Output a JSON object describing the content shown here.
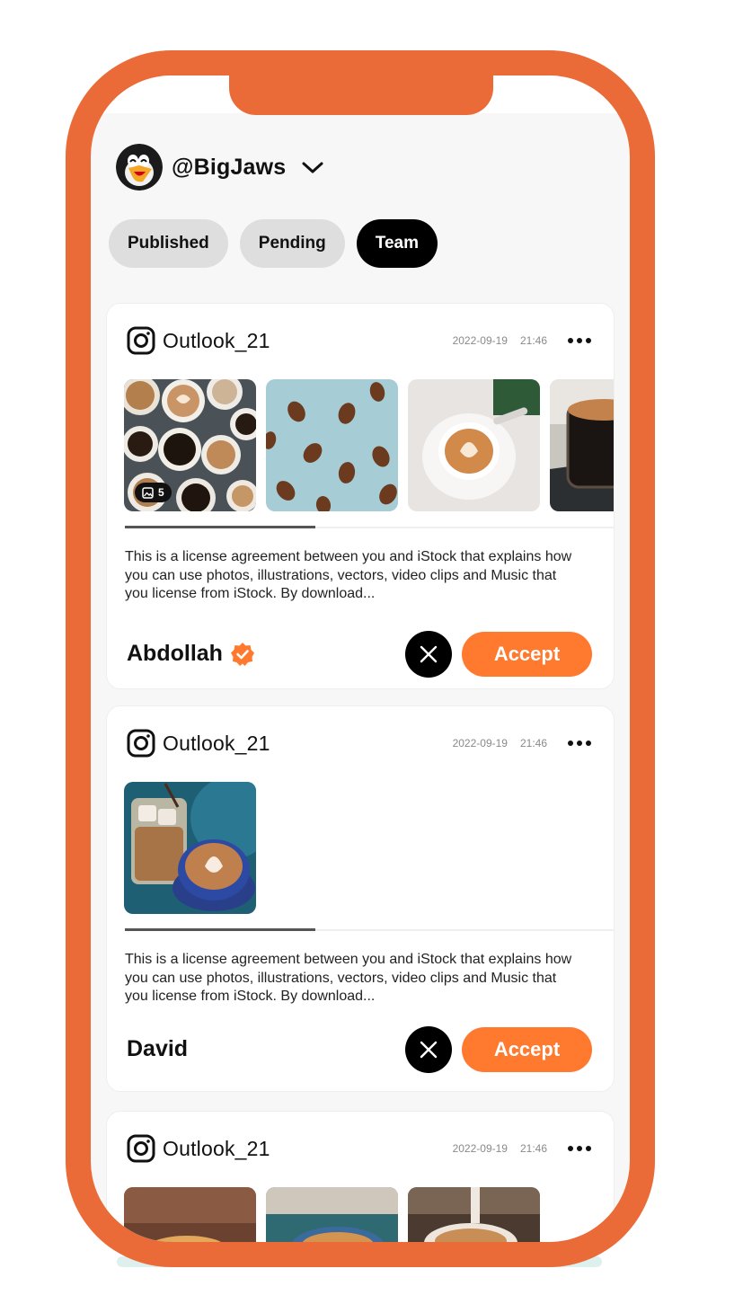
{
  "account": {
    "handle": "@BigJaws"
  },
  "tabs": [
    {
      "label": "Published",
      "active": false
    },
    {
      "label": "Pending",
      "active": false
    },
    {
      "label": "Team",
      "active": true
    }
  ],
  "posts": [
    {
      "account": "Outlook_21",
      "date": "2022-09-19",
      "time": "21:46",
      "image_count": "5",
      "images": [
        "coffee-cups-top",
        "coffee-beans",
        "latte-art",
        "espresso-glass"
      ],
      "description": "This is a license agreement between you and iStock that explains how you can use photos, illustrations, vectors, video clips and Music that you license from iStock. By download...",
      "author": "Abdollah",
      "verified": true,
      "accept_label": "Accept",
      "scroll_progress": 0.39
    },
    {
      "account": "Outlook_21",
      "date": "2022-09-19",
      "time": "21:46",
      "images": [
        "iced-coffee-and-latte"
      ],
      "description": "This is a license agreement between you and iStock that explains how you can use photos, illustrations, vectors, video clips and Music that you license from iStock. By download...",
      "author": "David",
      "verified": false,
      "accept_label": "Accept",
      "scroll_progress": 0.39
    },
    {
      "account": "Outlook_21",
      "date": "2022-09-19",
      "time": "21:46",
      "images": [
        "coffee-cup-wood",
        "cappuccino-teal",
        "milk-pour"
      ]
    }
  ],
  "colors": {
    "frame": "#ea6b37",
    "accent": "#ff7a2f",
    "verified": "#ff7a2f"
  }
}
